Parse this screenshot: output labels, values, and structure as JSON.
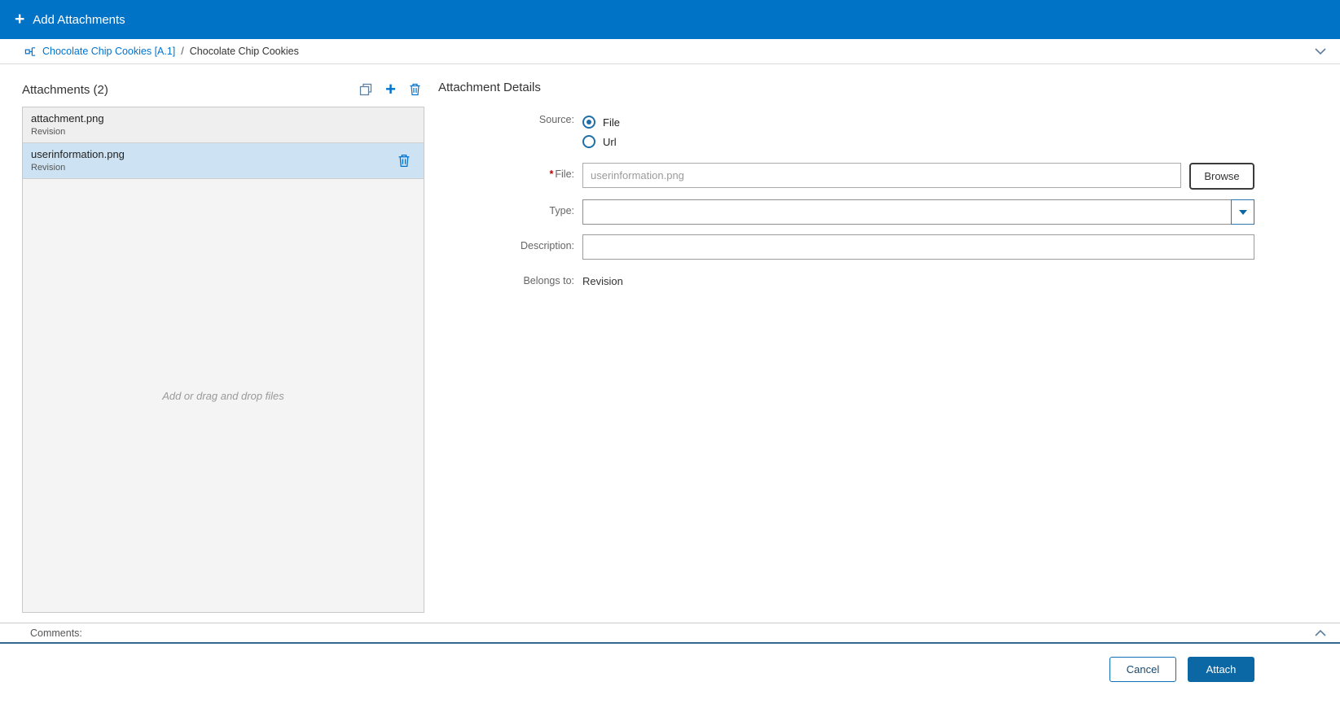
{
  "colors": {
    "header_blue": "#0173c7",
    "link_blue": "#0073cf",
    "selected_row_blue": "#cde3f3",
    "attach_button_blue": "#0b68a4",
    "required_red": "#c00000"
  },
  "header": {
    "add_icon_glyph": "+",
    "title": "Add Attachments"
  },
  "breadcrumb": {
    "root_label": "Chocolate Chip Cookies [A.1]",
    "separator": "/",
    "current_label": "Chocolate Chip Cookies"
  },
  "attachments_panel": {
    "title": "Attachments (2)",
    "add_icon_glyph": "+",
    "items": [
      {
        "name": "attachment.png",
        "belongs_to": "Revision",
        "selected": false
      },
      {
        "name": "userinformation.png",
        "belongs_to": "Revision",
        "selected": true
      }
    ],
    "dropzone_hint": "Add or drag and drop files"
  },
  "details_panel": {
    "title": "Attachment Details",
    "source": {
      "label": "Source:",
      "options": [
        {
          "label": "File",
          "selected": true
        },
        {
          "label": "Url",
          "selected": false
        }
      ]
    },
    "file": {
      "required_marker": "*",
      "label": "File:",
      "value": "userinformation.png",
      "browse_label": "Browse"
    },
    "type": {
      "label": "Type:",
      "value": ""
    },
    "description": {
      "label": "Description:",
      "value": ""
    },
    "belongs_to": {
      "label": "Belongs to:",
      "value": "Revision"
    }
  },
  "comments": {
    "label": "Comments:"
  },
  "footer": {
    "cancel_label": "Cancel",
    "attach_label": "Attach"
  }
}
